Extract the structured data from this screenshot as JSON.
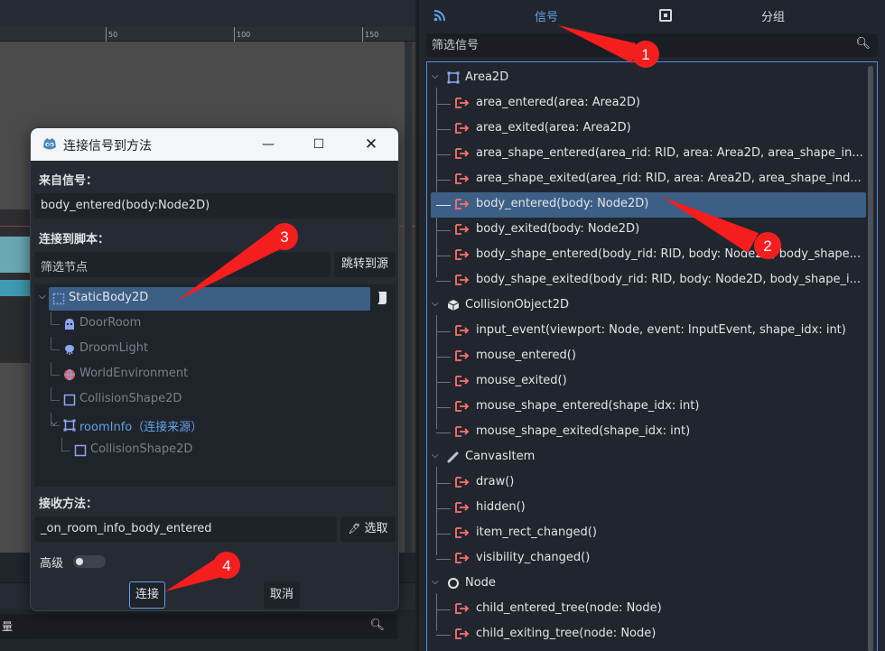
{
  "viewport": {
    "ruler_labels": [
      "50",
      "100",
      "150"
    ]
  },
  "bottom_left": {
    "search_cut_text": "量"
  },
  "signals_panel": {
    "tabs": {
      "signals": "信号",
      "groups": "分组"
    },
    "filter_placeholder": "筛选信号",
    "categories": [
      {
        "name": "Area2D",
        "signals": [
          "area_entered(area: Area2D)",
          "area_exited(area: Area2D)",
          "area_shape_entered(area_rid: RID, area: Area2D, area_shape_in...",
          "area_shape_exited(area_rid: RID, area: Area2D, area_shape_ind...",
          "body_entered(body: Node2D)",
          "body_exited(body: Node2D)",
          "body_shape_entered(body_rid: RID, body: Node2D, body_shape...",
          "body_shape_exited(body_rid: RID, body: Node2D, body_shape_i..."
        ]
      },
      {
        "name": "CollisionObject2D",
        "signals": [
          "input_event(viewport: Node, event: InputEvent, shape_idx: int)",
          "mouse_entered()",
          "mouse_exited()",
          "mouse_shape_entered(shape_idx: int)",
          "mouse_shape_exited(shape_idx: int)"
        ]
      },
      {
        "name": "CanvasItem",
        "signals": [
          "draw()",
          "hidden()",
          "item_rect_changed()",
          "visibility_changed()"
        ]
      },
      {
        "name": "Node",
        "signals": [
          "child_entered_tree(node: Node)",
          "child_exiting_tree(node: Node)"
        ]
      }
    ],
    "selected_signal": "body_entered(body: Node2D)"
  },
  "dialog": {
    "title": "连接信号到方法",
    "from_signal_label": "来自信号：",
    "from_signal_value": "body_entered(body:Node2D)",
    "connect_to_script_label": "连接到脚本：",
    "filter_nodes_placeholder": "筛选节点",
    "goto_source_button": "跳转到源",
    "nodes": [
      {
        "name": "StaticBody2D",
        "icon": "static-body-icon"
      },
      {
        "name": "DoorRoom",
        "icon": "door-room-icon"
      },
      {
        "name": "DroomLight",
        "icon": "light-icon"
      },
      {
        "name": "WorldEnvironment",
        "icon": "world-env-icon"
      },
      {
        "name": "CollisionShape2D",
        "icon": "collision-shape-icon"
      },
      {
        "name": "roomInfo",
        "suffix": "（连接来源）",
        "icon": "area2d-icon"
      },
      {
        "name": "CollisionShape2D",
        "icon": "collision-shape-icon"
      }
    ],
    "receiver_method_label": "接收方法：",
    "receiver_method_value": "_on_room_info_body_entered",
    "pick_button": "选取",
    "advanced_label": "高级",
    "connect_button": "连接",
    "cancel_button": "取消"
  },
  "annotations": [
    "1",
    "2",
    "3",
    "4"
  ],
  "colors": {
    "accent_blue": "#63a1ea",
    "selection": "#3d5f86",
    "annotation_red": "#f51e1e",
    "signal_icon": "#ff6f6f"
  }
}
